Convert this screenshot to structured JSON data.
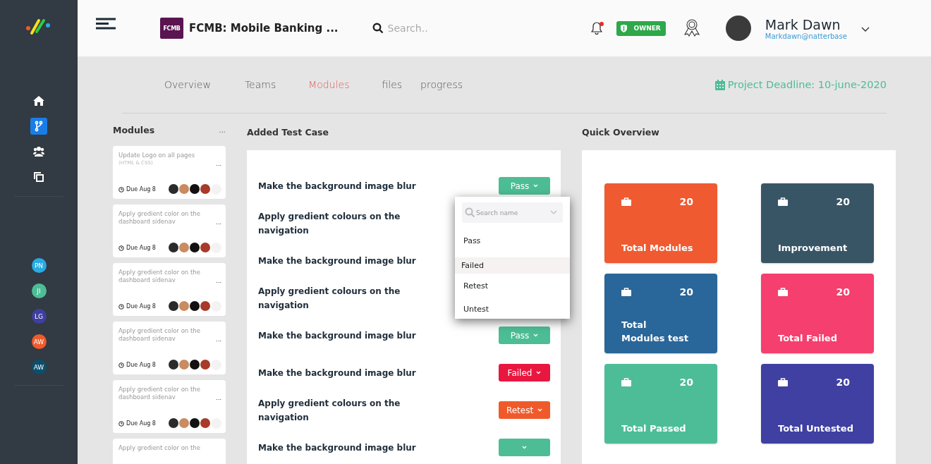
{
  "sidebar": {
    "nav": [
      {
        "selected": false
      },
      {
        "selected": true
      },
      {
        "selected": false
      },
      {
        "selected": false
      }
    ],
    "members": [
      {
        "initials": "PN",
        "color": "#29abe2"
      },
      {
        "initials": "JI",
        "color": "#4dbd95"
      },
      {
        "initials": "LG",
        "color": "#3f3fa0"
      },
      {
        "initials": "AW",
        "color": "#f05a2b"
      },
      {
        "initials": "AW",
        "color": "#0b4f6c"
      }
    ]
  },
  "header": {
    "project_logo": "FCMB",
    "project_title": "FCMB: Mobile Banking ...",
    "search": {
      "placeholder": "Search.."
    },
    "notification": true,
    "role_badge": "OWNER",
    "user": {
      "name": "Mark Dawn",
      "email": "Markdawn@natterbase"
    }
  },
  "tabs": [
    {
      "label": "Overview",
      "selected": false
    },
    {
      "label": "Teams",
      "selected": false
    },
    {
      "label": "Modules",
      "selected": true
    },
    {
      "label": "files",
      "selected": false
    },
    {
      "label": "progress",
      "selected": false
    }
  ],
  "deadline": "Project Deadline: 10-june-2020",
  "modules": {
    "title": "Modules",
    "more": "...",
    "cards": [
      {
        "title": "Update Logo on all pages",
        "subtitle": "(HTML & CSS)",
        "more": "...",
        "due": "Due Aug 8"
      },
      {
        "title": "Apply gredient color on the dashboard sidenav",
        "more": "...",
        "due": "Due Aug 8"
      },
      {
        "title": "Apply gredient color on the dashboard sidenav",
        "more": "...",
        "due": "Due Aug 8"
      },
      {
        "title": "Apply gredient color on the dashboard sidenav",
        "more": "...",
        "due": "Due Aug 8"
      },
      {
        "title": "Apply gredient color on the dashboard sidenav",
        "more": "...",
        "due": "Due Aug 8"
      },
      {
        "title": "Apply gredient color on the"
      }
    ]
  },
  "test_cases": {
    "title": "Added Test Case",
    "rows": [
      {
        "name": "Make the background image blur",
        "status": {
          "kind": "pass",
          "label": "Pass"
        }
      },
      {
        "name": "Apply gredient colours on the navigation"
      },
      {
        "name": "Make the background image blur"
      },
      {
        "name": "Apply gredient colours on the navigation"
      },
      {
        "name": "Make the background image blur",
        "status": {
          "kind": "pass",
          "label": "Pass"
        }
      },
      {
        "name": "Make the background image blur",
        "status": {
          "kind": "failed",
          "label": "Failed"
        }
      },
      {
        "name": "Apply gredient colours on the navigation",
        "status": {
          "kind": "retest",
          "label": "Retest"
        }
      },
      {
        "name": "Make the background image blur",
        "status": {
          "kind": "pass"
        }
      }
    ],
    "dropdown": {
      "search": {
        "placeholder": "Search name"
      },
      "options": [
        {
          "label": "Pass",
          "selected": false
        },
        {
          "label": "Failed",
          "selected": true
        },
        {
          "label": "Retest",
          "selected": false
        },
        {
          "label": "Untest",
          "selected": false
        }
      ]
    }
  },
  "overview": {
    "title": "Quick Overview",
    "tiles": [
      {
        "count": "20",
        "label": "Total Modules",
        "color": "#f05a31"
      },
      {
        "count": "20",
        "label": "Improvement",
        "color": "#385566"
      },
      {
        "count": "20",
        "label": "Total\nModules test",
        "color": "#296699"
      },
      {
        "count": "20",
        "label": "Total Failed",
        "color": "#f53f6e"
      },
      {
        "count": "20",
        "label": "Total Passed",
        "color": "#4dbd98"
      },
      {
        "count": "20",
        "label": "Total Untested",
        "color": "#3f40a2"
      }
    ]
  }
}
